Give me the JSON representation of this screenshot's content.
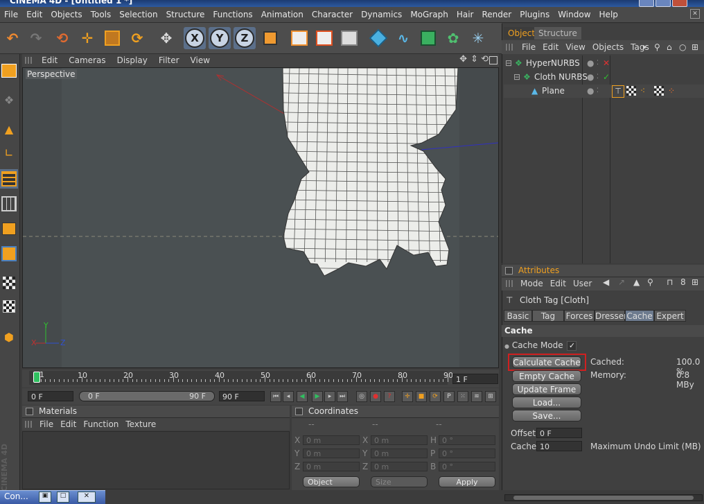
{
  "window": {
    "title": "CINEMA 4D - [Untitled 1 *]"
  },
  "menu": [
    "File",
    "Edit",
    "Objects",
    "Tools",
    "Selection",
    "Structure",
    "Functions",
    "Animation",
    "Character",
    "Dynamics",
    "MoGraph",
    "Hair",
    "Render",
    "Plugins",
    "Window",
    "Help"
  ],
  "toolbar": {
    "axis_x": "X",
    "axis_y": "Y",
    "axis_z": "Z",
    "icons": [
      "undo-icon",
      "redo-icon",
      "live-selection-icon",
      "move-icon",
      "scale-icon",
      "rotate-icon",
      "recent-tools-icon",
      "coordinate-system-icon",
      "render-view-icon",
      "render-picture-viewer-icon",
      "render-settings-icon",
      "cube-icon",
      "spline-icon",
      "nurbs-icon",
      "cloner-icon",
      "deformer-icon"
    ]
  },
  "viewport": {
    "menu": [
      "Edit",
      "Cameras",
      "Display",
      "Filter",
      "View"
    ],
    "label": "Perspective",
    "axis_labels": {
      "x": "X",
      "y": "Y",
      "z": "Z"
    }
  },
  "timeline": {
    "ticks": [
      0,
      10,
      20,
      30,
      40,
      50,
      60,
      70,
      80,
      90
    ],
    "current_frame_marker": "1",
    "frame_field": "1 F"
  },
  "transport": {
    "start_field": "0 F",
    "range_start": "0 F",
    "range_end": "90 F",
    "end_field": "90 F"
  },
  "materials": {
    "title": "Materials",
    "menu": [
      "File",
      "Edit",
      "Function",
      "Texture"
    ]
  },
  "coordinates": {
    "title": "Coordinates",
    "headers": [
      "--",
      "--",
      "--"
    ],
    "rows": [
      {
        "a": "X",
        "av": "0 m",
        "b": "X",
        "bv": "0 m",
        "c": "H",
        "cv": "0 °"
      },
      {
        "a": "Y",
        "av": "0 m",
        "b": "Y",
        "bv": "0 m",
        "c": "P",
        "cv": "0 °"
      },
      {
        "a": "Z",
        "av": "0 m",
        "b": "Z",
        "bv": "0 m",
        "c": "B",
        "cv": "0 °"
      }
    ],
    "mode_select": "Object",
    "size_select": "Size",
    "apply_label": "Apply"
  },
  "objects_panel": {
    "tabs": [
      "Objects",
      "Structure"
    ],
    "menu": [
      "File",
      "Edit",
      "View",
      "Objects",
      "Tags"
    ],
    "items": [
      {
        "name": "HyperNURBS",
        "status": "✕",
        "status_color": "#e03030"
      },
      {
        "name": "Cloth NURBS",
        "status": "✓",
        "status_color": "#30c030"
      },
      {
        "name": "Plane",
        "status": "",
        "status_color": "#888888"
      }
    ]
  },
  "attributes": {
    "title": "Attributes",
    "menu": [
      "Mode",
      "Edit",
      "User"
    ],
    "object_title": "Cloth Tag [Cloth]",
    "tabs": [
      "Basic",
      "Tag",
      "Forces",
      "Dresser",
      "Cache",
      "Expert"
    ],
    "active_tab": "Cache",
    "section": "Cache",
    "cache_mode_label": "Cache Mode",
    "cache_mode_check": "✓",
    "buttons": [
      "Calculate Cache",
      "Empty Cache",
      "Update Frame",
      "Load...",
      "Save..."
    ],
    "cached_label": "Cached:",
    "cached_value": "100.0 %",
    "memory_label": "Memory:",
    "memory_value": "0.8 MBy",
    "offset_label": "Offset",
    "offset_value": "0 F",
    "cache_label": "Cache",
    "cache_value": "10",
    "undo_limit_label": "Maximum Undo Limit (MB)"
  },
  "brand": "CINEMA 4D",
  "taskbar": {
    "label": "Con..."
  },
  "colors": {
    "accent": "#f0a020",
    "highlight_box": "#d02020",
    "selection": "#5b6f8a"
  }
}
